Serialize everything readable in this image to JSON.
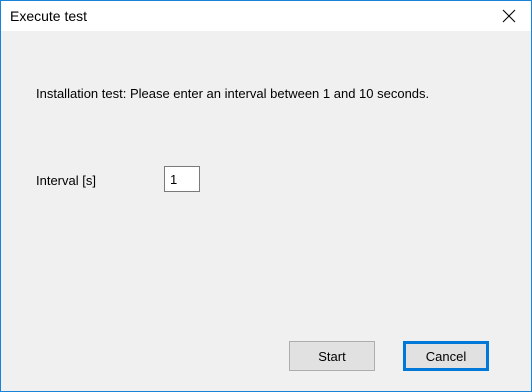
{
  "window": {
    "title": "Execute test",
    "close_icon": "close-icon",
    "accent_color": "#0078d7"
  },
  "dialog": {
    "message": "Installation test: Please enter an interval between 1 and 10 seconds.",
    "interval_label": "Interval [s]",
    "interval_value": "1"
  },
  "buttons": {
    "start_label": "Start",
    "cancel_label": "Cancel"
  }
}
